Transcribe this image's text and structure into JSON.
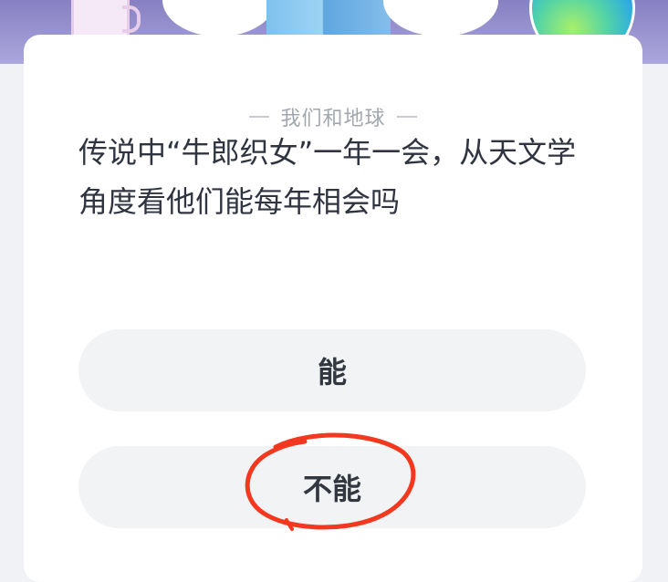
{
  "header": {
    "title": "我们和地球"
  },
  "question": {
    "text": "传说中“牛郎织女”一年一会，从天文学角度看他们能每年相会吗"
  },
  "options": [
    {
      "label": "能"
    },
    {
      "label": "不能"
    }
  ],
  "colors": {
    "banner": "#9b95d1",
    "card": "#ffffff",
    "option_bg": "#f1f3f5",
    "annotation": "#f2391f"
  }
}
